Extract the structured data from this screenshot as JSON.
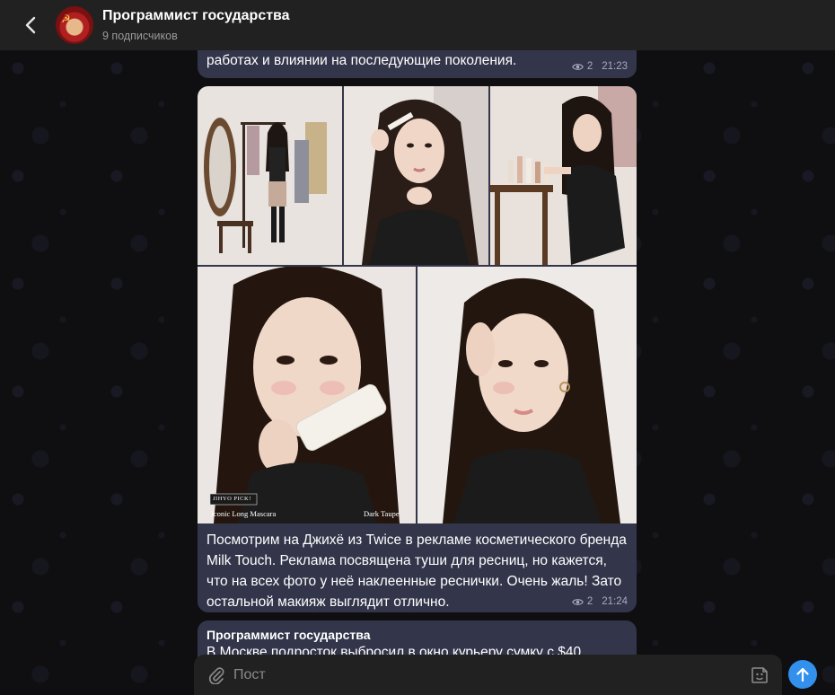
{
  "header": {
    "title": "Программист государства",
    "subtitle": "9 подписчиков",
    "avatar_emblem": "☭"
  },
  "messages": [
    {
      "text": "работах и влиянии на последующие поколения.",
      "views": "2",
      "time": "21:23"
    },
    {
      "photos": [
        {
          "caption": ""
        },
        {
          "caption": ""
        },
        {
          "caption": ""
        },
        {
          "caption": "Iconic Long Mascara",
          "badge": "JIHYO PICK!"
        },
        {
          "caption": "Dark Taupe"
        }
      ],
      "text": "Посмотрим на Джихё из Twice в рекламе косметического бренда Milk Touch. Реклама посвящена туши для ресниц, но кажется, что на всех фото у неё наклеенные реснички. Очень жаль! Зато остальной макияж выглядит отлично.",
      "views": "2",
      "time": "21:24"
    },
    {
      "sender": "Программист государства",
      "text": "В Москве подросток выбросил в окно курьеру сумку с $40"
    }
  ],
  "composer": {
    "placeholder": "Пост"
  },
  "icons": {
    "back": "chevron-left-icon",
    "views": "eye-icon",
    "attach": "paperclip-icon",
    "sticker": "sticker-icon",
    "send": "arrow-up-icon"
  },
  "colors": {
    "header_bg": "#212121",
    "bubble_bg": "#33354a",
    "accent": "#3390ec",
    "meta_text": "#a7aac0",
    "subtitle_text": "#9a9a9a"
  }
}
